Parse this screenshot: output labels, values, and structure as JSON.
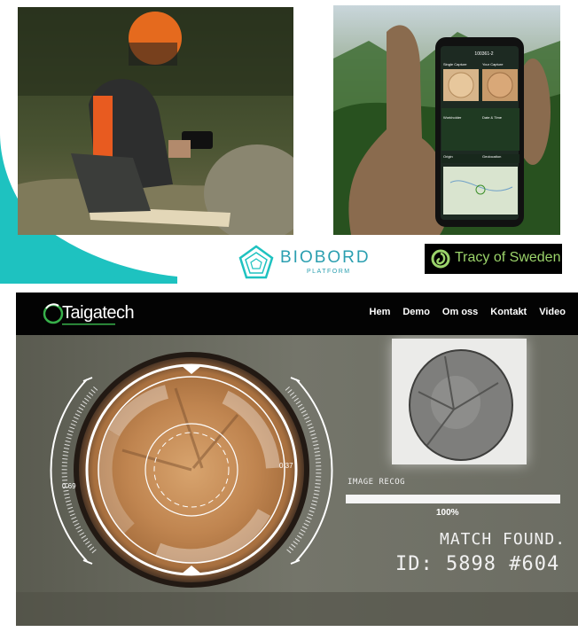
{
  "logos": {
    "biobord_word": "BIOBORD",
    "biobord_sub": "PLATFORM",
    "tracy": "Tracy of Sweden"
  },
  "phone_app": {
    "title": "100361-2",
    "tab_left": "Single Capture",
    "tab_right": "Your Capture",
    "field_1": "Workholder",
    "field_2": "Date & Time",
    "field_3": "Origin",
    "field_4": "Geolocation"
  },
  "taigatech": {
    "brand": "Taigatech",
    "nav": [
      "Hem",
      "Demo",
      "Om oss",
      "Kontakt",
      "Video"
    ],
    "image_recog_label": "IMAGE RECOG",
    "progress_value": "100%",
    "progress_fraction": 1.0,
    "match_found": "MATCH FOUND.",
    "match_id": "ID: 5898 #604",
    "gauge_left": "0.69",
    "gauge_right": "0.37"
  },
  "colors": {
    "teal": "#1ec2c0",
    "biobord_blue": "#2b9fb0",
    "tracy_green": "#9bd36a",
    "hud_white": "#f5f5f5"
  }
}
